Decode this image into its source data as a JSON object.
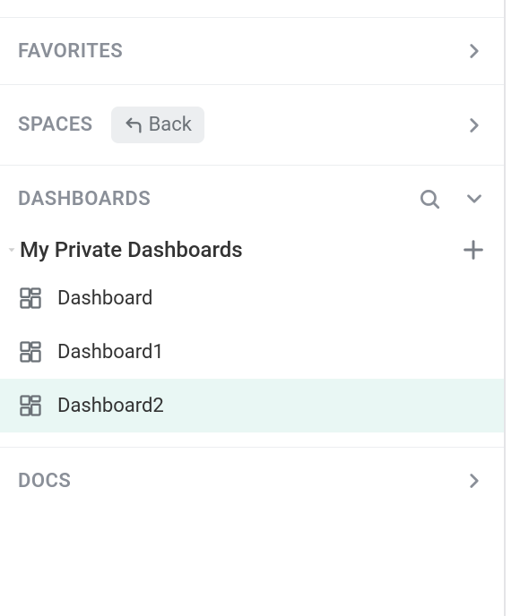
{
  "sections": {
    "favorites": {
      "title": "FAVORITES"
    },
    "spaces": {
      "title": "SPACES",
      "back_label": "Back"
    },
    "dashboards": {
      "title": "DASHBOARDS",
      "group_title": "My Private Dashboards",
      "items": [
        {
          "label": "Dashboard",
          "active": false
        },
        {
          "label": "Dashboard1",
          "active": false
        },
        {
          "label": "Dashboard2",
          "active": true
        }
      ]
    },
    "docs": {
      "title": "DOCS"
    }
  }
}
